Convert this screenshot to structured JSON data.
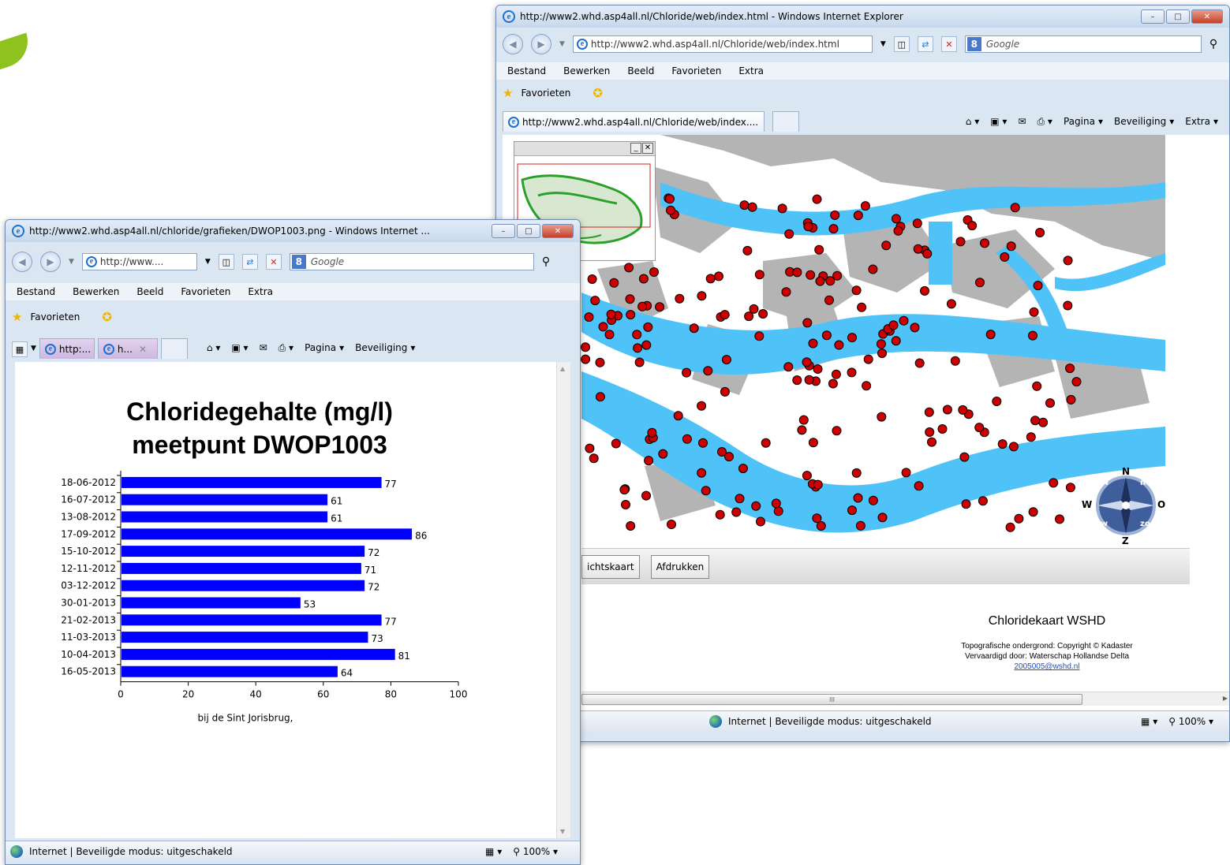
{
  "map_window": {
    "title": "http://www2.whd.asp4all.nl/Chloride/web/index.html - Windows Internet Explorer",
    "address": "http://www2.whd.asp4all.nl/Chloride/web/index.html",
    "search_placeholder": "Google",
    "menu": [
      "Bestand",
      "Bewerken",
      "Beeld",
      "Favorieten",
      "Extra"
    ],
    "favorites_label": "Favorieten",
    "tab_label": "http://www2.whd.asp4all.nl/Chloride/web/index....",
    "commands": {
      "page": "Pagina",
      "security": "Beveiliging",
      "extra": "Extra"
    },
    "buttons": {
      "overview": "ichtskaart",
      "print": "Afdrukken"
    },
    "credits": {
      "title": "Chloridekaart WSHD",
      "line1": "Topografische ondergrond: Copyright © Kadaster",
      "line2": "Vervaardigd door: Waterschap Hollandse Delta",
      "email": "2005005@wshd.nl"
    },
    "scroll_grip": "III",
    "status": {
      "zone": "Internet | Beveiligde modus: uitgeschakeld",
      "zoom": "100%"
    },
    "compass": {
      "n": "N",
      "s": "Z",
      "e": "O",
      "w": "W",
      "nw": "nw",
      "ne": "no",
      "sw": "zw",
      "se": "zo"
    },
    "colors": {
      "water": "#4fc3f7",
      "urban": "#b4b4b4",
      "measure_point": "#cc0000"
    }
  },
  "chart_window": {
    "title": "http://www2.whd.asp4all.nl/chloride/grafieken/DWOP1003.png - Windows Internet ...",
    "address": "http://www....",
    "search_placeholder": "Google",
    "menu": [
      "Bestand",
      "Bewerken",
      "Beeld",
      "Favorieten",
      "Extra"
    ],
    "favorites_label": "Favorieten",
    "tabs": [
      "http:...",
      "h..."
    ],
    "commands": {
      "page": "Pagina",
      "security": "Beveiliging"
    },
    "status": {
      "zone": "Internet | Beveiligde modus: uitgeschakeld",
      "zoom": "100%"
    }
  },
  "chart_data": {
    "type": "bar",
    "orientation": "horizontal",
    "title": "Chloridegehalte (mg/l)",
    "subtitle": "meetpunt DWOP1003",
    "xlabel": "bij de Sint Jorisbrug,",
    "categories": [
      "18-06-2012",
      "16-07-2012",
      "13-08-2012",
      "17-09-2012",
      "15-10-2012",
      "12-11-2012",
      "03-12-2012",
      "30-01-2013",
      "21-02-2013",
      "11-03-2013",
      "10-04-2013",
      "16-05-2013"
    ],
    "values": [
      77,
      61,
      61,
      86,
      72,
      71,
      72,
      53,
      77,
      73,
      81,
      64
    ],
    "xlim": [
      0,
      100
    ],
    "xticks": [
      0,
      20,
      40,
      60,
      80,
      100
    ],
    "bar_color": "#0000ff",
    "data_labels": true,
    "grid": false
  }
}
